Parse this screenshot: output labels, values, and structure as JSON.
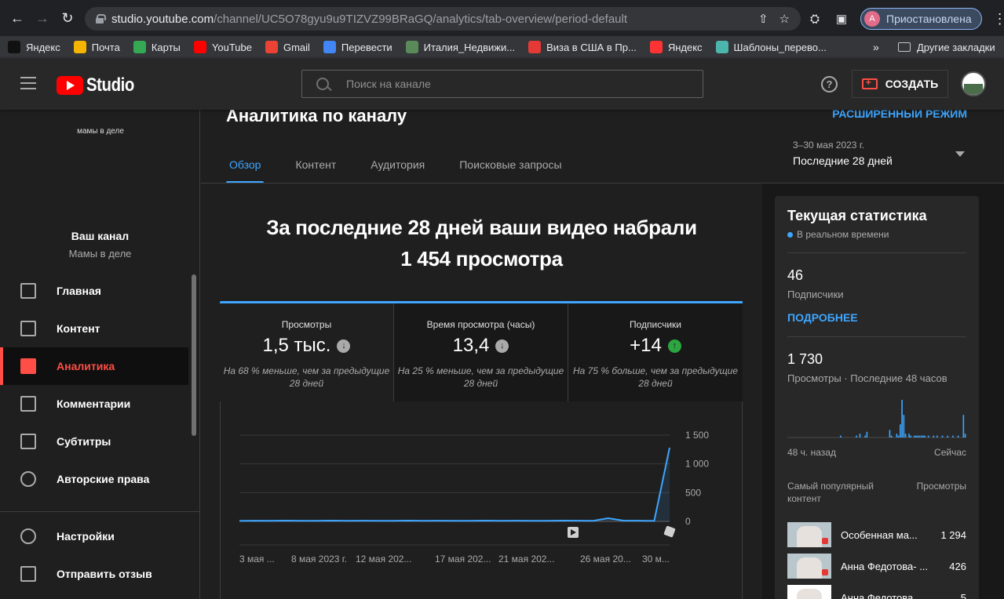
{
  "browser": {
    "url_host": "studio.youtube.com",
    "url_path": "/channel/UC5O78gyu9u9TIZVZ99BRaGQ/analytics/tab-overview/period-default",
    "profile_initial": "A",
    "profile_label": "Приостановлена",
    "bookmarks": [
      {
        "label": "Яндекс",
        "color": "#111111",
        "icon": "ya-star-icon"
      },
      {
        "label": "Почта",
        "color": "#f4b400",
        "icon": "mail-icon"
      },
      {
        "label": "Карты",
        "color": "#34a853",
        "icon": "map-pin-icon"
      },
      {
        "label": "YouTube",
        "color": "#ff0000",
        "icon": "youtube-icon"
      },
      {
        "label": "Gmail",
        "color": "#ea4335",
        "icon": "gmail-icon"
      },
      {
        "label": "Перевести",
        "color": "#4285f4",
        "icon": "translate-icon"
      },
      {
        "label": "Италия_Недвижи...",
        "color": "#5a8a5a",
        "icon": "site-icon"
      },
      {
        "label": "Виза в США в Пр...",
        "color": "#e53935",
        "icon": "letter-a-icon"
      },
      {
        "label": "Яндекс",
        "color": "#ff3333",
        "icon": "ya-icon"
      },
      {
        "label": "Шаблоны_перево...",
        "color": "#4db6ac",
        "icon": "site-icon"
      }
    ],
    "bookmarks_more": "»",
    "other_bookmarks": "Другие закладки"
  },
  "header": {
    "logo_text": "Studio",
    "search_placeholder": "Поиск на канале",
    "create_label": "СОЗДАТЬ"
  },
  "sidebar": {
    "channel_thumb_text": "мамы в деле",
    "channel_title": "Ваш канал",
    "channel_name": "Мамы в деле",
    "items": [
      {
        "label": "Главная",
        "icon": "dashboard-icon",
        "active": false
      },
      {
        "label": "Контент",
        "icon": "content-icon",
        "active": false
      },
      {
        "label": "Аналитика",
        "icon": "analytics-icon",
        "active": true
      },
      {
        "label": "Комментарии",
        "icon": "comments-icon",
        "active": false
      },
      {
        "label": "Субтитры",
        "icon": "subtitles-icon",
        "active": false
      },
      {
        "label": "Авторские права",
        "icon": "copyright-icon",
        "active": false
      }
    ],
    "bottom_items": [
      {
        "label": "Настройки",
        "icon": "settings-icon"
      },
      {
        "label": "Отправить отзыв",
        "icon": "feedback-icon"
      }
    ]
  },
  "main": {
    "page_title": "Аналитика по каналу",
    "advanced_link": "РАСШИРЕННЫЙ РЕЖИМ",
    "tabs": [
      "Обзор",
      "Контент",
      "Аудитория",
      "Поисковые запросы"
    ],
    "active_tab": "Обзор",
    "period_dates": "3–30 мая 2023 г.",
    "period_label": "Последние 28 дней",
    "headline_line1": "За последние 28 дней ваши видео набрали",
    "headline_line2": "1 454 просмотра",
    "metrics": [
      {
        "label": "Просмотры",
        "value": "1,5 тыс.",
        "trend": "down",
        "note": "На 68 % меньше, чем за предыдущие 28 дней"
      },
      {
        "label": "Время просмотра (часы)",
        "value": "13,4",
        "trend": "down",
        "note": "На 25 % меньше, чем за предыдущие 28 дней"
      },
      {
        "label": "Подписчики",
        "value": "+14",
        "trend": "up",
        "note": "На 75 % больше, чем за предыдущие 28 дней"
      }
    ]
  },
  "chart_data": {
    "type": "line",
    "title": "",
    "xlabel": "",
    "ylabel": "",
    "x_tick_labels": [
      "3 мая ...",
      "8 мая 2023 г.",
      "12 мая 202...",
      "17 мая 202...",
      "21 мая 202...",
      "26 мая 20...",
      "30 м..."
    ],
    "y_tick_labels": [
      "1 500",
      "1 000",
      "500",
      "0"
    ],
    "ylim": [
      0,
      1500
    ],
    "grid": true,
    "series": [
      {
        "values": [
          8,
          12,
          10,
          14,
          9,
          11,
          13,
          10,
          12,
          9,
          11,
          14,
          10,
          12,
          11,
          9,
          13,
          10,
          12,
          11,
          10,
          14,
          12,
          10,
          55,
          14,
          12,
          8,
          1280
        ]
      }
    ],
    "color": "#3ea6ff"
  },
  "realtime": {
    "title": "Текущая статистика",
    "live_label": "В реальном времени",
    "subscribers_value": "46",
    "subscribers_label": "Подписчики",
    "details_link": "ПОДРОБНЕЕ",
    "views_value": "1 730",
    "views_label": "Просмотры · Последние 48 часов",
    "axis_left": "48 ч. назад",
    "axis_right": "Сейчас",
    "spark_values": [
      0,
      0,
      0,
      0,
      0,
      0,
      0,
      0,
      0,
      0,
      0,
      0,
      0,
      0,
      0,
      0,
      0,
      0,
      0,
      0,
      0,
      0,
      0,
      0,
      0,
      0,
      0,
      0,
      0,
      0,
      1,
      0,
      0,
      0,
      0,
      0,
      0,
      0,
      0,
      1,
      0,
      2,
      0,
      0,
      1,
      3,
      0,
      0,
      0,
      0,
      0,
      0,
      0,
      0,
      0,
      0,
      0,
      0,
      4,
      1,
      0,
      0,
      2,
      1,
      7,
      20,
      12,
      2,
      0,
      2,
      1,
      0,
      1,
      1,
      1,
      1,
      1,
      1,
      1,
      0,
      1,
      0,
      0,
      1,
      0,
      1,
      0,
      0,
      1,
      0,
      0,
      1,
      0,
      0,
      1,
      0,
      0,
      1,
      0,
      0,
      12,
      2
    ],
    "top_content_header": "Самый популярный контент",
    "top_views_header": "Просмотры",
    "top_content": [
      {
        "title": "Особенная ма...",
        "views": "1 294"
      },
      {
        "title": "Анна Федотова- ...",
        "views": "426"
      },
      {
        "title": "Анна Федотова, мн...",
        "views": "5"
      }
    ]
  }
}
